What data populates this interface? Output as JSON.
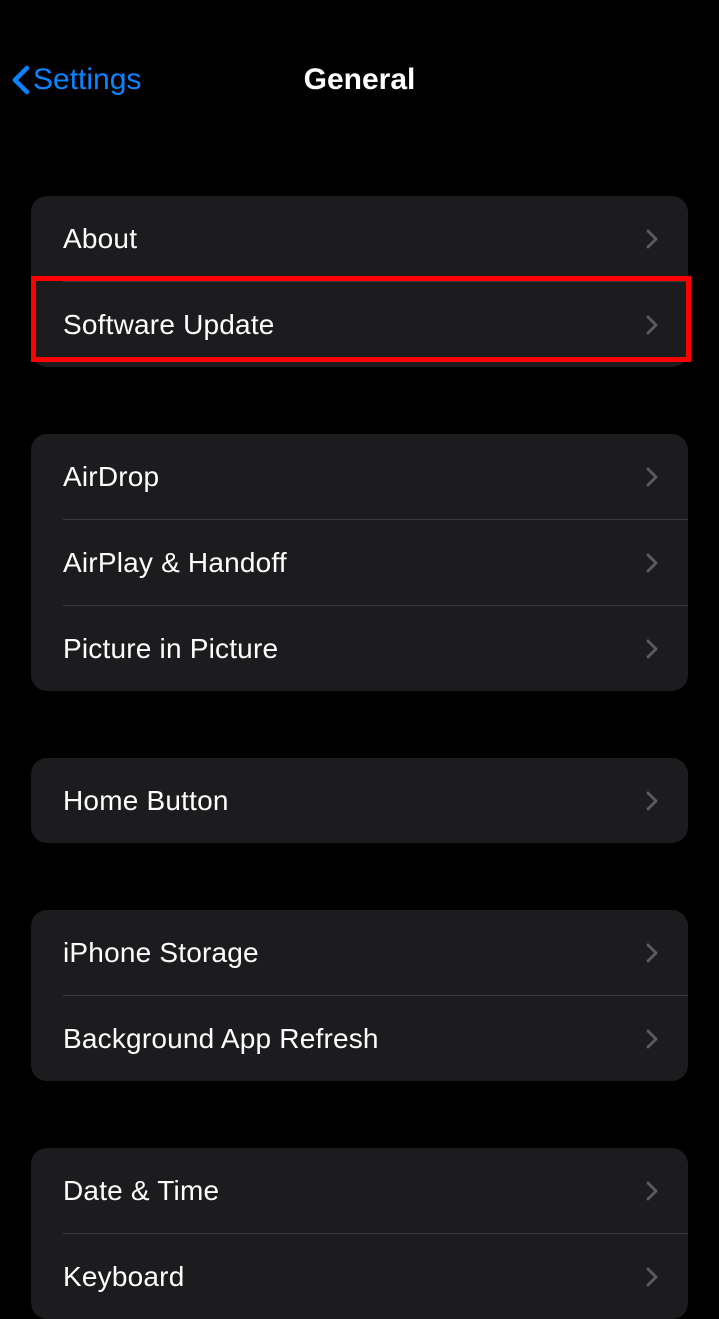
{
  "nav": {
    "back_label": "Settings",
    "title": "General"
  },
  "groups": [
    {
      "rows": [
        {
          "label": "About"
        },
        {
          "label": "Software Update",
          "highlighted": true
        }
      ]
    },
    {
      "rows": [
        {
          "label": "AirDrop"
        },
        {
          "label": "AirPlay & Handoff"
        },
        {
          "label": "Picture in Picture"
        }
      ]
    },
    {
      "rows": [
        {
          "label": "Home Button"
        }
      ]
    },
    {
      "rows": [
        {
          "label": "iPhone Storage"
        },
        {
          "label": "Background App Refresh"
        }
      ]
    },
    {
      "rows": [
        {
          "label": "Date & Time"
        },
        {
          "label": "Keyboard"
        }
      ]
    }
  ]
}
